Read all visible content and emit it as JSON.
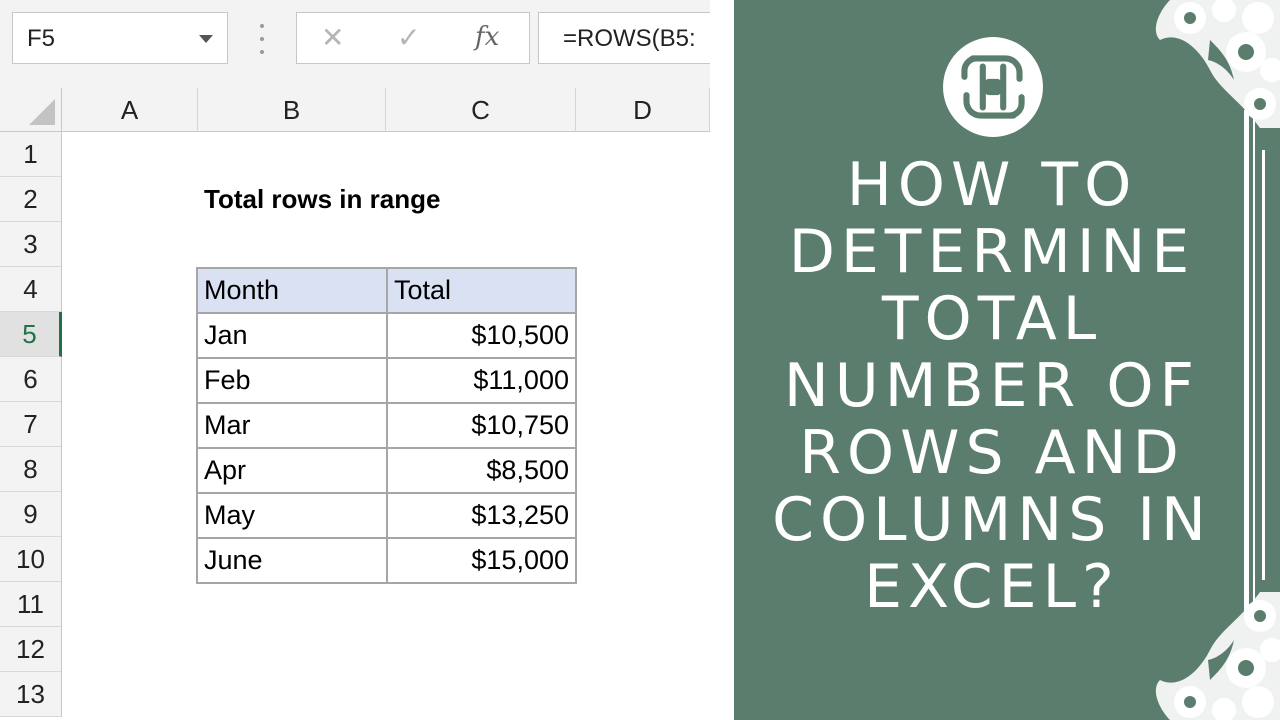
{
  "excel": {
    "name_box": "F5",
    "formula": "=ROWS(B5:",
    "columns": [
      "A",
      "B",
      "C",
      "D"
    ],
    "rows": [
      "1",
      "2",
      "3",
      "4",
      "5",
      "6",
      "7",
      "8",
      "9",
      "10",
      "11",
      "12",
      "13"
    ],
    "active_row": "5",
    "sheet_title": "Total rows in range",
    "table": {
      "headers": [
        "Month",
        "Total"
      ],
      "rows": [
        [
          "Jan",
          "$10,500"
        ],
        [
          "Feb",
          "$11,000"
        ],
        [
          "Mar",
          "$10,750"
        ],
        [
          "Apr",
          "$8,500"
        ],
        [
          "May",
          "$13,250"
        ],
        [
          "June",
          "$15,000"
        ]
      ]
    },
    "icons": {
      "cancel": "close-icon",
      "enter": "check-icon",
      "function": "fx-icon"
    },
    "colors": {
      "active_accent": "#217346",
      "header_fill": "#dae1f3"
    }
  },
  "banner": {
    "headline": [
      "HOW TO",
      "DETERMINE",
      "TOTAL",
      "NUMBER OF",
      "ROWS AND",
      "COLUMNS IN",
      "EXCEL?"
    ],
    "background": "#5a7d6d",
    "logo": "brand-logo-icon"
  }
}
